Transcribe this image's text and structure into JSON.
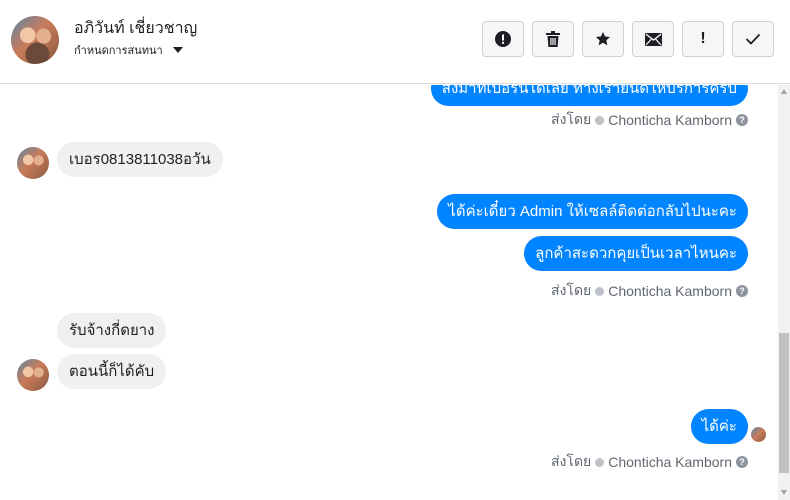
{
  "header": {
    "contact_name": "อภิวันท์ เชี่ยวชาญ",
    "conversation_settings": "กำหนดการสนทนา",
    "actions": {
      "report": "report-icon",
      "delete": "trash-icon",
      "star": "star-icon",
      "mark_unread": "envelope-icon",
      "important": "!",
      "done": "check-icon"
    }
  },
  "messages": {
    "top_cut": "ส่งมาที่เบอร์นี้ได้เลย ทางเรายินดีให้บริการครับ",
    "m1": "เบอร0813811038อวัน",
    "m2": "ได้ค่ะเดี๋ยว Admin ให้เซลล์ติดต่อกลับไปนะคะ",
    "m3": "ลูกค้าสะดวกคุยเป็นเวลาไหนคะ",
    "m4": "รับจ้างกี่ดยาง",
    "m5": "ตอนนี้ก็ได้คับ",
    "m6": "ได้ค่ะ"
  },
  "sent_by": {
    "prefix": "ส่งโดย",
    "name": "Chonticha Kamborn",
    "help": "?"
  },
  "colors": {
    "outgoing_bubble": "#0084ff",
    "incoming_bubble": "#f1f0f0",
    "meta_text": "#606770"
  }
}
